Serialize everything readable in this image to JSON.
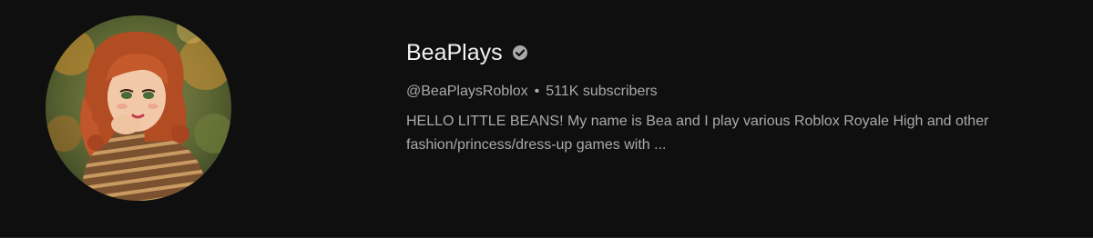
{
  "channel": {
    "name": "BeaPlays",
    "verified": true,
    "handle": "@BeaPlaysRoblox",
    "separator": "•",
    "subscribers": "511K subscribers",
    "description": "HELLO LITTLE BEANS! My name is Bea and I play various Roblox Royale High and other fashion/princess/dress-up games with ..."
  },
  "icons": {
    "verified": "check-circle-icon"
  },
  "colors": {
    "background": "#0f0f0f",
    "name_text": "#f1f1f1",
    "secondary_text": "#aaaaaa",
    "verified_badge": "#aaaaaa",
    "avatar_hair": "#c0562a",
    "avatar_sweater_base": "#7a5230",
    "avatar_sweater_stripe": "#c99a62",
    "avatar_background": "#4e5a2e"
  }
}
